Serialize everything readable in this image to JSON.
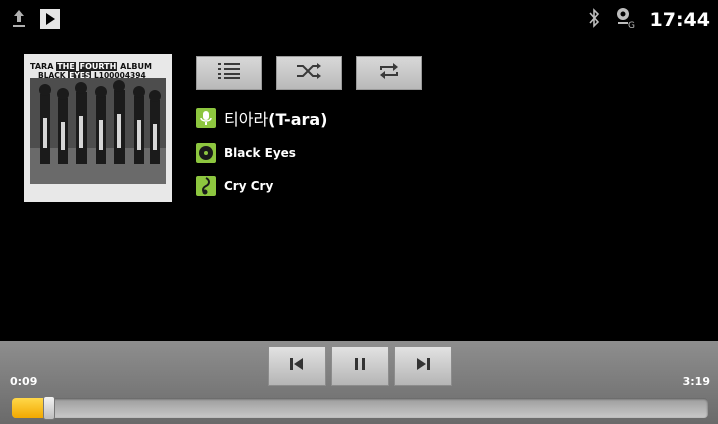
{
  "status_bar": {
    "time": "17:44",
    "icons": [
      "upload-icon",
      "play-notification-icon",
      "bluetooth-icon",
      "gps-signal-icon"
    ]
  },
  "album": {
    "cover_text_line1_a": "TARA",
    "cover_text_line1_b": "THE",
    "cover_text_line1_c": "FOURTH",
    "cover_text_line1_d": "ALBUM",
    "cover_text_line2_a": "BLACK",
    "cover_text_line2_b": "EYES",
    "cover_text_line2_c": "L100004394"
  },
  "controls": {
    "buttons": [
      "playlist-icon",
      "shuffle-icon",
      "repeat-icon"
    ]
  },
  "track_info": {
    "artist_prefix": "티아라",
    "artist_suffix": "(T-ara)",
    "album": "Black Eyes",
    "song": "Cry Cry"
  },
  "playback": {
    "elapsed": "0:09",
    "duration": "3:19",
    "progress_fraction": 0.045
  },
  "colors": {
    "accent_green": "#8dc63f",
    "progress_yellow": "#f2a800"
  }
}
